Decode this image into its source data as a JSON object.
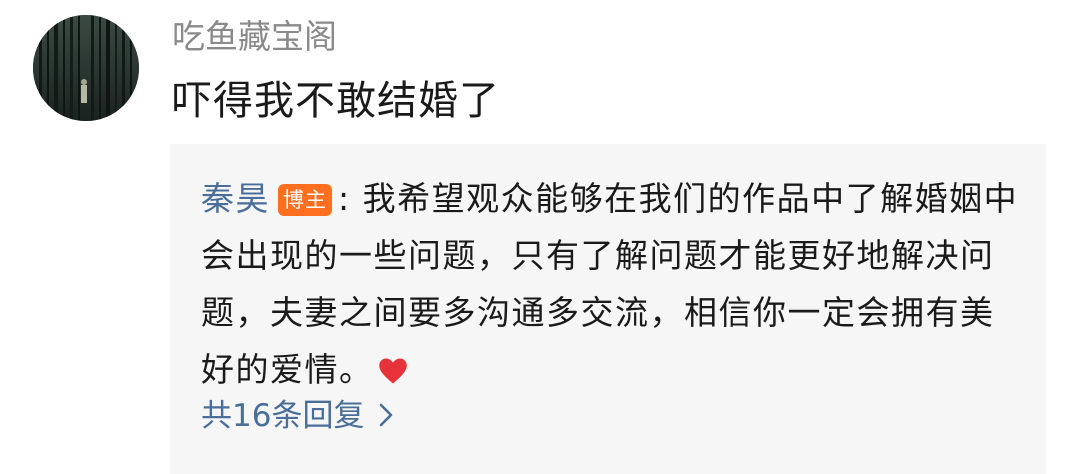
{
  "comment": {
    "username": "吃鱼藏宝阁",
    "text": "吓得我不敢结婚了",
    "avatar_icon": "avatar-forest-icon"
  },
  "reply": {
    "author": "秦昊",
    "author_badge": "博主",
    "separator": ": ",
    "text": "我希望观众能够在我们的作品中了解婚姻中会出现的一些问题，只有了解问题才能更好地解决问题，夫妻之间要多沟通多交流，相信你一定会拥有美好的爱情。",
    "emoji_icon": "red-heart-icon",
    "reply_count_label": "共16条回复",
    "link_color": "#4a6e9a",
    "badge_color": "#ff6f1f"
  }
}
